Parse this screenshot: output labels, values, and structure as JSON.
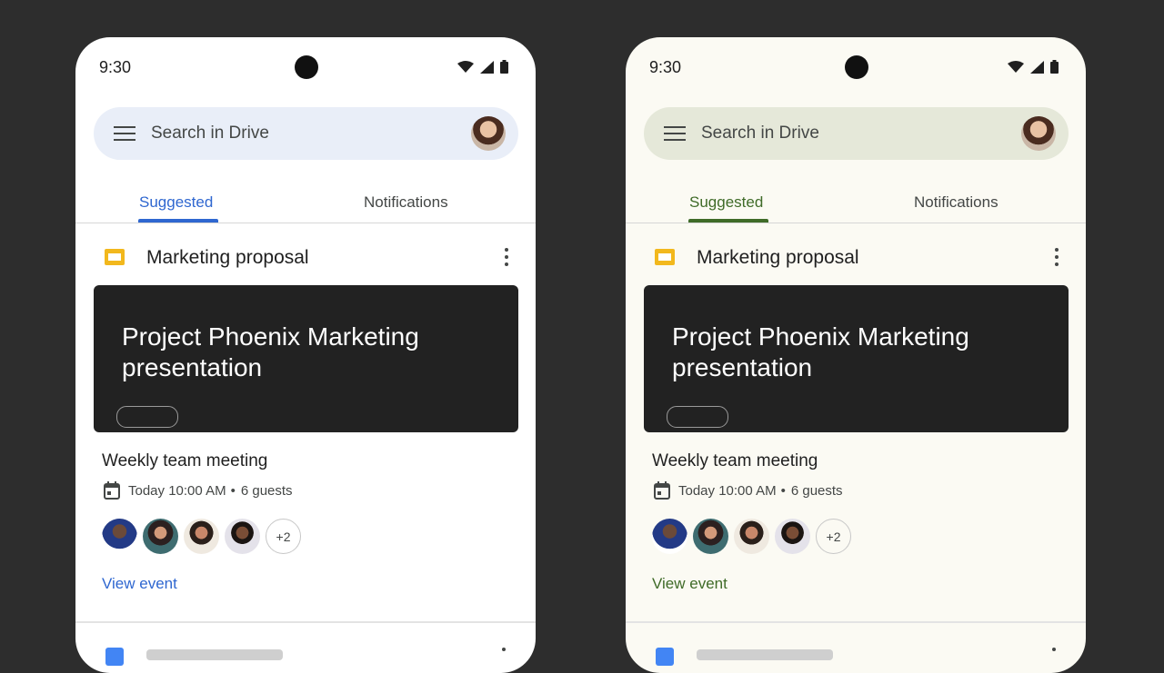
{
  "phones": [
    {
      "status": {
        "time": "9:30"
      },
      "search": {
        "placeholder": "Search in Drive"
      },
      "tabs": [
        "Suggested",
        "Notifications"
      ],
      "card": {
        "title": "Marketing proposal",
        "thumbnail_title": "Project Phoenix Marketing presentation"
      },
      "event": {
        "title": "Weekly team meeting",
        "time": "Today 10:00 AM",
        "guests": "6 guests",
        "more_guests": "+2",
        "link": "View event"
      },
      "accent": "#2f67d0"
    },
    {
      "status": {
        "time": "9:30"
      },
      "search": {
        "placeholder": "Search in Drive"
      },
      "tabs": [
        "Suggested",
        "Notifications"
      ],
      "card": {
        "title": "Marketing proposal",
        "thumbnail_title": "Project Phoenix Marketing presentation"
      },
      "event": {
        "title": "Weekly team meeting",
        "time": "Today 10:00 AM",
        "guests": "6 guests",
        "more_guests": "+2",
        "link": "View event"
      },
      "accent": "#3f6b28"
    }
  ],
  "icons": {
    "menu": "hamburger-menu-icon",
    "wifi": "wifi-icon",
    "signal": "signal-icon",
    "battery": "battery-icon",
    "more": "more-vert-icon",
    "slides": "slides-icon",
    "calendar": "calendar-icon"
  }
}
